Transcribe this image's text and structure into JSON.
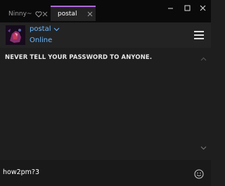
{
  "tabs": [
    {
      "label": "Ninny~",
      "active": false
    },
    {
      "label": "postal",
      "active": true
    }
  ],
  "header": {
    "chat_name": "postal",
    "status": "Online"
  },
  "messages": {
    "system_notice": "NEVER TELL YOUR PASSWORD TO ANYONE."
  },
  "composer": {
    "value": "how2pm?3"
  },
  "icons": {
    "heart": "heart-icon",
    "close": "close-icon",
    "minimize": "minimize-icon",
    "maximize": "maximize-icon",
    "chevron": "chevron-down-icon",
    "menu": "hamburger-menu-icon",
    "emoji": "smiley-icon"
  },
  "colors": {
    "accent": "#6bb8ff",
    "tab_indicator": "#b06ad8",
    "titlebar": "#0a0a0a",
    "background": "#1e1e1e"
  }
}
